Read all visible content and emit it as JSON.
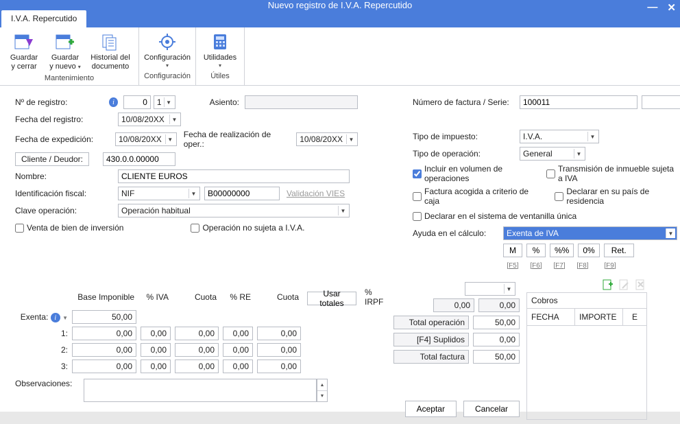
{
  "title": "Nuevo registro de I.V.A. Repercutido",
  "tab": "I.V.A. Repercutido",
  "ribbon": {
    "mantenimiento": "Mantenimiento",
    "configuracion": "Configuración",
    "utiles": "Útiles",
    "btn_guardar_cerrar_l1": "Guardar",
    "btn_guardar_cerrar_l2": "y cerrar",
    "btn_guardar_nuevo_l1": "Guardar",
    "btn_guardar_nuevo_l2": "y nuevo",
    "btn_historial_l1": "Historial del",
    "btn_historial_l2": "documento",
    "btn_config": "Configuración",
    "btn_utilidades": "Utilidades"
  },
  "left": {
    "n_registro": "Nº de registro:",
    "n_registro_v1": "0",
    "n_registro_v2": "1",
    "asiento": "Asiento:",
    "fecha_registro": "Fecha del registro:",
    "fecha_registro_v": "10/08/20XX",
    "fecha_exped": "Fecha de expedición:",
    "fecha_exped_v": "10/08/20XX",
    "fecha_real": "Fecha de realización de oper.:",
    "fecha_real_v": "10/08/20XX",
    "cliente_btn": "Cliente / Deudor:",
    "cliente_v": "430.0.0.00000",
    "nombre": "Nombre:",
    "nombre_v": "CLIENTE EUROS",
    "ident": "Identificación fiscal:",
    "ident_tipo": "NIF",
    "ident_v": "B00000000",
    "val_vies": "Validación VIES",
    "clave": "Clave operación:",
    "clave_v": "Operación habitual",
    "chk_vbi": "Venta de bien de inversión",
    "chk_ons": "Operación no sujeta a I.V.A."
  },
  "right": {
    "num_fact": "Número de factura / Serie:",
    "num_fact_v": "100011",
    "tipo_imp": "Tipo de impuesto:",
    "tipo_imp_v": "I.V.A.",
    "tipo_oper": "Tipo de operación:",
    "tipo_oper_v": "General",
    "chk_vol": "Incluir en volumen de operaciones",
    "chk_trans": "Transmisión de inmueble sujeta a IVA",
    "chk_caja": "Factura acogida a criterio de caja",
    "chk_pais": "Declarar en su país de residencia",
    "chk_vent": "Declarar en el sistema de ventanilla única",
    "ayuda": "Ayuda en el cálculo:",
    "ayuda_v": "Exenta de IVA",
    "btn_M": "M",
    "btn_pct": "%",
    "btn_pctpct": "%%",
    "btn_0pct": "0%",
    "btn_ret": "Ret.",
    "k_f5": "[F5]",
    "k_f6": "[F6]",
    "k_f7": "[F7]",
    "k_f8": "[F8]",
    "k_f9": "[F9]"
  },
  "grid": {
    "h_bi": "Base Imponible",
    "h_iva": "% IVA",
    "h_cuota": "Cuota",
    "h_re": "% RE",
    "h_cuota2": "Cuota",
    "usar_totales": "Usar totales",
    "h_irpf": "% IRPF",
    "exenta": "Exenta:",
    "r1": "1:",
    "r2": "2:",
    "r3": "3:",
    "v_exenta": "50,00",
    "zero": "0,00"
  },
  "totals": {
    "top_v": "0,00",
    "top_v2": "0,00",
    "t_oper": "Total operación",
    "t_oper_v": "50,00",
    "t_supl": "[F4] Suplidos",
    "t_supl_v": "0,00",
    "t_fact": "Total factura",
    "t_fact_v": "50,00"
  },
  "obs": "Observaciones:",
  "cobros": {
    "title": "Cobros",
    "c_fecha": "FECHA",
    "c_imp": "IMPORTE",
    "c_e": "E"
  },
  "actions": {
    "aceptar": "Aceptar",
    "cancelar": "Cancelar"
  }
}
